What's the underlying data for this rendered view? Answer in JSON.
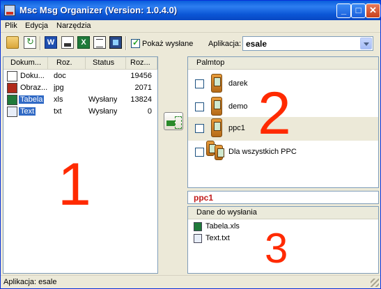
{
  "window": {
    "title": "Msc Msg Organizer (Version: 1.0.4.0)"
  },
  "menu": {
    "items": [
      "Plik",
      "Edycja",
      "Narzędzia"
    ]
  },
  "toolbar": {
    "icons": [
      "open-folder-icon",
      "refresh-icon",
      "word-icon",
      "pdf-icon",
      "excel-icon",
      "notepad-icon",
      "image-icon"
    ],
    "show_sent_label": "Pokaż wysłane",
    "show_sent_checked": true,
    "app_label": "Aplikacja:",
    "app_value": "esale"
  },
  "documents": {
    "columns": [
      "Dokum...",
      "Roz.",
      "Status",
      "Roz..."
    ],
    "rows": [
      {
        "name": "Doku...",
        "ext": "doc",
        "status": "",
        "size": "19456",
        "icon": "word-doc-icon"
      },
      {
        "name": "Obraz...",
        "ext": "jpg",
        "status": "",
        "size": "2071",
        "icon": "jpg-image-icon"
      },
      {
        "name": "Tabela",
        "ext": "xls",
        "status": "Wysłany",
        "size": "13824",
        "icon": "excel-doc-icon",
        "selected": true
      },
      {
        "name": "Text",
        "ext": "txt",
        "status": "Wysłany",
        "size": "0",
        "icon": "text-file-icon",
        "selected": true
      }
    ]
  },
  "palmtop": {
    "header": "Palmtop",
    "devices": [
      {
        "label": "darek",
        "checked": false
      },
      {
        "label": "demo",
        "checked": false
      },
      {
        "label": "ppc1",
        "checked": false,
        "highlighted": true
      },
      {
        "label": "Dla wszystkich PPC",
        "checked": false
      }
    ]
  },
  "selected_device": "ppc1",
  "send_data": {
    "header": "Dane do wysłania",
    "files": [
      "Tabela.xls",
      "Text.txt"
    ]
  },
  "annotations": {
    "one": "1",
    "two": "2",
    "three": "3"
  },
  "status": {
    "text": "Aplikacja: esale"
  },
  "colors": {
    "annotation": "#ff2a00",
    "selection": "#316ac5",
    "title_bar": "#0a5ddc",
    "device_label": "#c01a1a"
  }
}
